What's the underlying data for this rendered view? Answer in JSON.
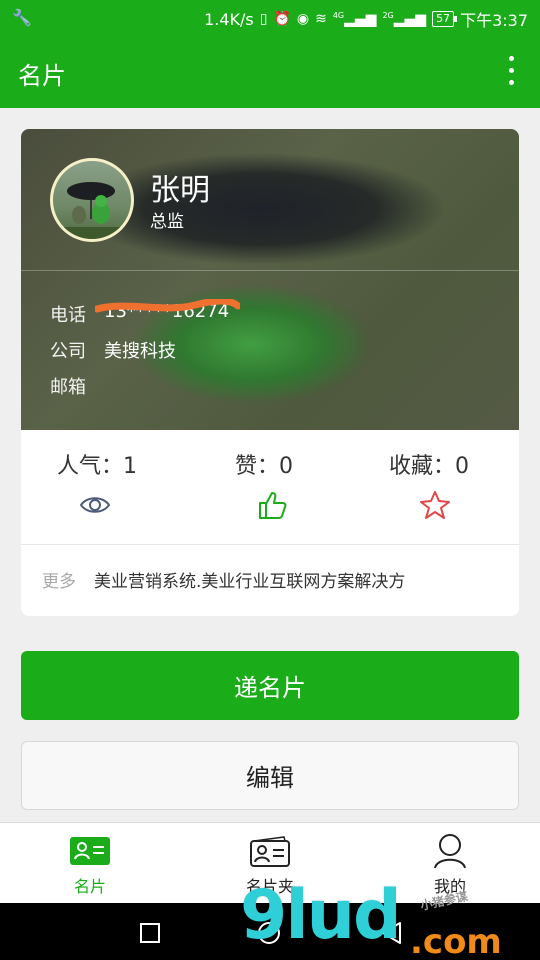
{
  "status_bar": {
    "net_speed": "1.4K/s",
    "net_4g": "4G",
    "net_2g": "2G",
    "battery": "57",
    "time": "下午3:37"
  },
  "app_bar": {
    "title": "名片"
  },
  "card": {
    "name": "张明",
    "title": "总监",
    "rows": [
      {
        "label": "电话",
        "value": "13*****16274"
      },
      {
        "label": "公司",
        "value": "美搜科技"
      },
      {
        "label": "邮箱",
        "value": ""
      }
    ],
    "stats": {
      "popularity": "人气：1",
      "likes": "赞：0",
      "favorites": "收藏：0"
    },
    "more_label": "更多",
    "more_text": "美业营销系统.美业行业互联网方案解决方"
  },
  "buttons": {
    "send": "递名片",
    "edit": "编辑"
  },
  "tabs": [
    {
      "label": "名片"
    },
    {
      "label": "名片夹"
    },
    {
      "label": "我的"
    }
  ],
  "watermark": {
    "main": "9lud",
    "suffix": ".com",
    "small": "小猪参谋"
  },
  "colors": {
    "primary": "#1aad19",
    "like": "#1aad19",
    "favorite": "#e04848",
    "view": "#4d5a78"
  }
}
